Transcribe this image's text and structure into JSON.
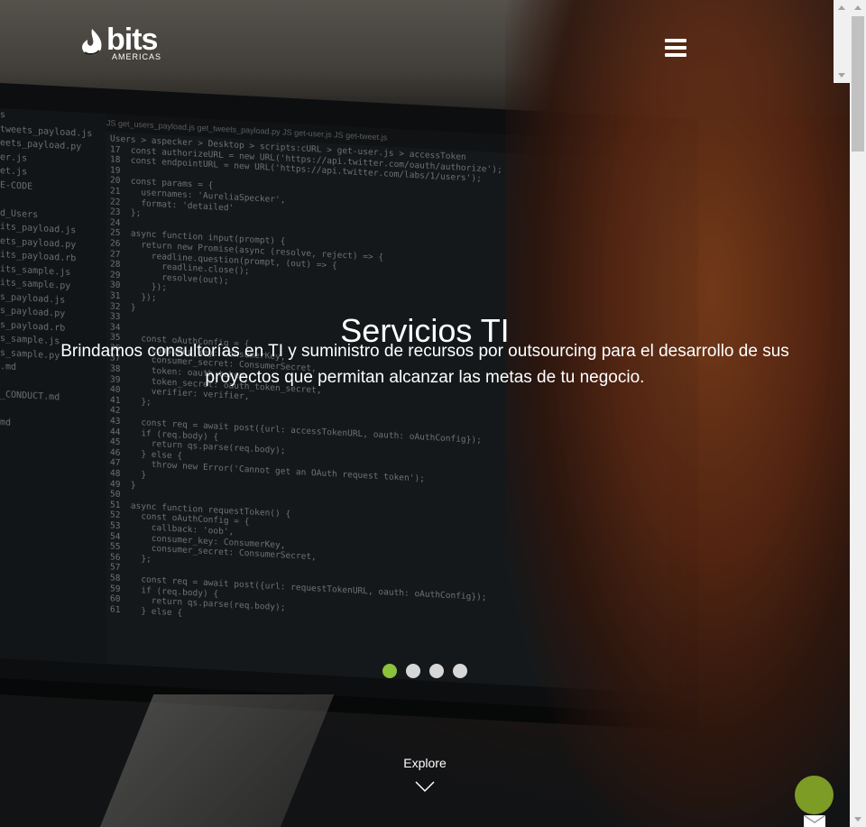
{
  "brand": {
    "name": "bits",
    "sub": "AMERICAS"
  },
  "hero": {
    "title": "Servicios TI",
    "subtitle": "Brindamos consultorías en TI y suministro de recursos por outsourcing para el desarrollo de sus proyectos que permitan alcanzar las metas de tu negocio."
  },
  "carousel": {
    "count": 4,
    "active": 0
  },
  "explore": {
    "label": "Explore"
  },
  "editor": {
    "tabs": "JS get_users_payload.js    get_tweets_payload.py    JS get-user.js    JS get-tweet.js",
    "sidebar": [
      "s",
      "tweets_payload.js",
      "eets_payload.py",
      "er.js",
      "et.js",
      "E-CODE",
      "",
      "d_Users",
      "its_payload.js",
      "ets_payload.py",
      "its_payload.rb",
      "its_sample.js",
      "its_sample.py",
      "s_payload.js",
      "s_payload.py",
      "s_payload.rb",
      "s_sample.js",
      "s_sample.py",
      ".md",
      "",
      "_CONDUCT.md",
      "",
      "md"
    ],
    "code": "Users > aspecker > Desktop > scripts:cURL > get-user.js > accessToken\n17  const authorizeURL = new URL('https://api.twitter.com/oauth/authorize');\n18  const endpointURL = new URL('https://api.twitter.com/labs/1/users');\n19\n20  const params = {\n21    usernames: 'AureliaSpecker',\n22    format: 'detailed'\n23  };\n24\n25  async function input(prompt) {\n26    return new Promise(async (resolve, reject) => {\n27      readline.question(prompt, (out) => {\n28        readline.close();\n29        resolve(out);\n30      });\n31    });\n32  }\n33\n34\n35    const oAuthConfig = {\n36      consumer_key: ConsumerKey,\n37      consumer_secret: ConsumerSecret,\n38      token: oauth_token,\n39      token_secret: oauth_token_secret,\n40      verifier: verifier,\n41    };\n42\n43    const req = await post({url: accessTokenURL, oauth: oAuthConfig});\n44    if (req.body) {\n45      return qs.parse(req.body);\n46    } else {\n47      throw new Error('Cannot get an OAuth request token');\n48    }\n49  }\n50\n51  async function requestToken() {\n52    const oAuthConfig = {\n53      callback: 'oob',\n54      consumer_key: ConsumerKey,\n55      consumer_secret: ConsumerSecret,\n56    };\n57\n58    const req = await post({url: requestTokenURL, oauth: oAuthConfig});\n59    if (req.body) {\n60      return qs.parse(req.body);\n61    } else {"
  },
  "colors": {
    "accent": "#8dc23d",
    "chat": "#7d9c26"
  },
  "icons": {
    "menu": "hamburger-icon",
    "chat": "chat-bubble-icon",
    "mail": "mail-icon",
    "chevron": "chevron-down-icon"
  }
}
